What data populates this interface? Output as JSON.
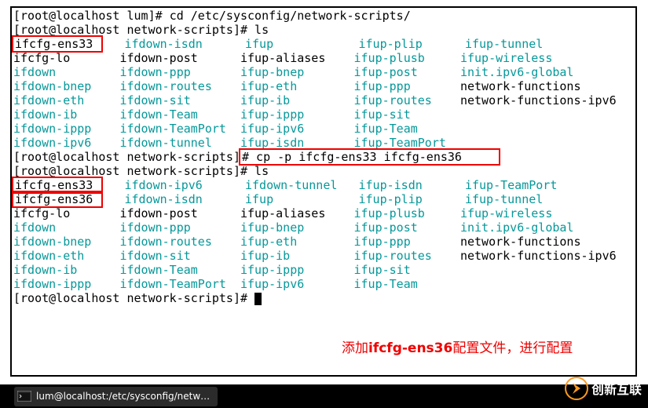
{
  "prompt1": "[root@localhost lum]# ",
  "cmd1": "cd /etc/sysconfig/network-scripts/",
  "prompt2": "[root@localhost network-scripts]# ",
  "cmd2": "ls",
  "hl1": "ifcfg-ens33",
  "ls1": {
    "c0": [
      "ifcfg-ens33",
      "ifcfg-lo",
      "ifdown",
      "ifdown-bnep",
      "ifdown-eth",
      "ifdown-ib",
      "ifdown-ippp",
      "ifdown-ipv6"
    ],
    "c1": [
      "ifdown-isdn",
      "ifdown-post",
      "ifdown-ppp",
      "ifdown-routes",
      "ifdown-sit",
      "ifdown-Team",
      "ifdown-TeamPort",
      "ifdown-tunnel"
    ],
    "c2": [
      "ifup",
      "ifup-aliases",
      "ifup-bnep",
      "ifup-eth",
      "ifup-ib",
      "ifup-ippp",
      "ifup-ipv6",
      "ifup-isdn"
    ],
    "c3": [
      "ifup-plip",
      "ifup-plusb",
      "ifup-post",
      "ifup-ppp",
      "ifup-routes",
      "ifup-sit",
      "ifup-Team",
      "ifup-TeamPort"
    ],
    "c4": [
      "ifup-tunnel",
      "ifup-wireless",
      "init.ipv6-global",
      "network-functions",
      "network-functions-ipv6",
      "",
      "",
      ""
    ]
  },
  "prompt3": "[root@localhost network-scripts]",
  "cmd3_full": "# cp -p ifcfg-ens33 ifcfg-ens36",
  "prompt4": "[root@localhost network-scripts]# ",
  "cmd4": "ls",
  "hl2a": "ifcfg-ens33",
  "hl2b": "ifcfg-ens36",
  "ls2": {
    "c0": [
      "ifcfg-ens33",
      "ifcfg-ens36",
      "ifcfg-lo",
      "ifdown",
      "ifdown-bnep",
      "ifdown-eth",
      "ifdown-ib",
      "ifdown-ippp"
    ],
    "c1": [
      "ifdown-ipv6",
      "ifdown-isdn",
      "ifdown-post",
      "ifdown-ppp",
      "ifdown-routes",
      "ifdown-sit",
      "ifdown-Team",
      "ifdown-TeamPort"
    ],
    "c2": [
      "ifdown-tunnel",
      "ifup",
      "ifup-aliases",
      "ifup-bnep",
      "ifup-eth",
      "ifup-ib",
      "ifup-ippp",
      "ifup-ipv6"
    ],
    "c3": [
      "ifup-isdn",
      "ifup-plip",
      "ifup-plusb",
      "ifup-post",
      "ifup-ppp",
      "ifup-routes",
      "ifup-sit",
      "ifup-Team"
    ],
    "c4": [
      "ifup-TeamPort",
      "ifup-tunnel",
      "ifup-wireless",
      "init.ipv6-global",
      "network-functions",
      "network-functions-ipv6",
      "",
      ""
    ]
  },
  "prompt5": "[root@localhost network-scripts]# ",
  "colors": {
    "plain_items": [
      "ifcfg-ens33",
      "ifcfg-ens36",
      "ifcfg-lo",
      "ifdown-post",
      "ifup-aliases",
      "network-functions",
      "network-functions-ipv6"
    ],
    "cyan_default": true
  },
  "annotation_pre": "添加",
  "annotation_bold": "ifcfg-ens36",
  "annotation_post": "配置文件，进行配置",
  "taskbar_label": "lum@localhost:/etc/sysconfig/netw…",
  "watermark_text": "创新互联"
}
